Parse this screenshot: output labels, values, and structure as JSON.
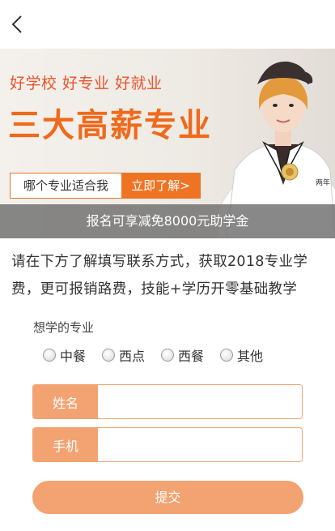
{
  "icons": {
    "back": "chevron-left-icon"
  },
  "banner": {
    "slogan": "好学校 好专业 好就业",
    "title": "三大高薪专业",
    "quiz_question": "哪个专业适合我",
    "quiz_button": "立即了解>",
    "grant_text": "报名可享减免8000元助学金",
    "jacket_text": "两年"
  },
  "intro": "请在下方了解填写联系方式，获取2018专业学费，更可报销路费，技能+学历开零基础教学",
  "form": {
    "major_label": "想学的专业",
    "majors": [
      {
        "label": "中餐"
      },
      {
        "label": "西点"
      },
      {
        "label": "西餐"
      },
      {
        "label": "其他"
      }
    ],
    "name_label": "姓名",
    "name_value": "",
    "phone_label": "手机",
    "phone_value": "",
    "submit": "提交"
  },
  "colors": {
    "accent": "#ee7424",
    "field_label_bg": "#f3a271",
    "slogan": "#e8542a",
    "title": "#ef6a1c"
  }
}
